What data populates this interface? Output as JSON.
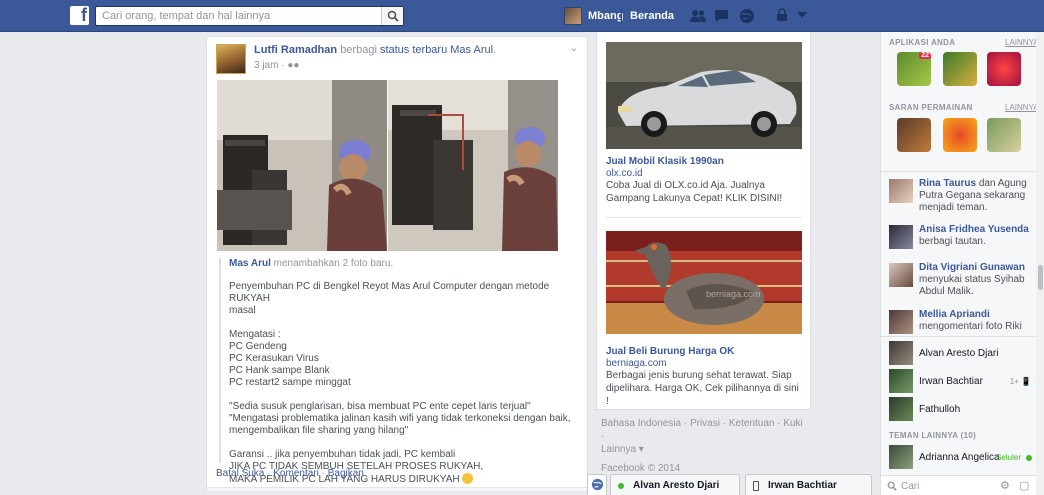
{
  "header": {
    "search_placeholder": "Cari orang, tempat dan hal lainnya",
    "user_name": "Mbang",
    "home_label": "Beranda",
    "icons": [
      "friend-requests-icon",
      "messages-icon",
      "notifications-icon",
      "privacy-shortcuts-icon",
      "settings-dropdown-icon"
    ]
  },
  "story": {
    "actor": "Lutfi Ramadhan",
    "verb": "berbagi",
    "link_text": "status terbaru Mas Arul",
    "period": ".",
    "time": "3 jam",
    "sep": " · ",
    "audience_icon": "friends-icon",
    "shared": {
      "author": "Mas Arul",
      "action": "menambahkan 2 foto baru.",
      "intro_lines": [
        "Penyembuhan PC di Bengkel Reyot Mas Arul Computer dengan metode RUKYAH",
        "masal"
      ],
      "list_lines": [
        "Mengatasi :",
        "PC Gendeng",
        "PC Kerasukan Virus",
        "PC Hank sampe Blank",
        "PC restart2 sampe minggat"
      ],
      "quote_lines": [
        "\"Sedia susuk penglarisan, bisa membuat PC ente cepet laris terjual\"",
        "\"Mengatasi problematika jalinan kasih wifi yang tidak terkoneksi dengan baik,",
        "mengembalikan file sharing yang hilang\""
      ],
      "guarantee_lines": [
        "Garansi .. jika penyembuhan tidak jadi, PC kembali",
        "JIKA PC TIDAK SEMBUH SETELAH PROSES RUKYAH,",
        "MAKA PEMILIK PC LAH YANG HARUS DIRUKYAH"
      ]
    },
    "actions": [
      "Batal Suka",
      "Komentari",
      "Bagikan"
    ],
    "action_sep": " · "
  },
  "ads": [
    {
      "title": "Jual Mobil Klasik 1990an",
      "domain": "olx.co.id",
      "body": "Coba Jual di OLX.co.id Aja. Jualnya Gampang Lakunya Cepat! KLIK DISINI!"
    },
    {
      "title": "Jual Beli Burung Harga OK",
      "domain": "berniaga.com",
      "body": "Berbagai jenis burung sehat terawat. Siap dipelihara. Harga OK, Cek pilihannya di sini !",
      "watermark": "berniaga.com"
    }
  ],
  "footer": {
    "links_line1": "Bahasa Indonesia · Privasi · Ketentuan · Kuki ·",
    "links_line2": "Lainnya ▾",
    "copyright": "Facebook © 2014"
  },
  "sidebar": {
    "apps_header": "APLIKASI ANDA",
    "apps_more": "LAINNYA",
    "apps_badge": "22",
    "games_header": "SARAN PERMAINAN",
    "games_more": "LAINNYA",
    "ticker": [
      {
        "name": "Rina Taurus",
        "text": " dan Agung Putra Gegana sekarang menjadi teman."
      },
      {
        "name": "Anisa Fridhea Yusenda",
        "text": " berbagi tautan."
      },
      {
        "name": "Dita Vigriani Gunawan",
        "text": " menyukai status Syihab Abdul Malik."
      },
      {
        "name": "Mellia Apriandi",
        "text": " mengomentari foto Riki"
      }
    ],
    "chat": [
      {
        "name": "Alvan Aresto Djari",
        "extra": ""
      },
      {
        "name": "Irwan Bachtiar",
        "extra": "1+ 📱"
      },
      {
        "name": "Fathulloh",
        "extra": ""
      }
    ],
    "other_friends_header": "TEMAN LAINNYA (10)",
    "other_friend": {
      "name": "Adrianna Angelica",
      "status": "Seluler"
    },
    "chat_search_placeholder": "Cari"
  },
  "chat_tabs": [
    {
      "name": "Alvan Aresto Djari"
    },
    {
      "name": "Irwan Bachtiar"
    }
  ],
  "colors": {
    "brand_blue": "#3b5998",
    "online_green": "#42b72a"
  }
}
